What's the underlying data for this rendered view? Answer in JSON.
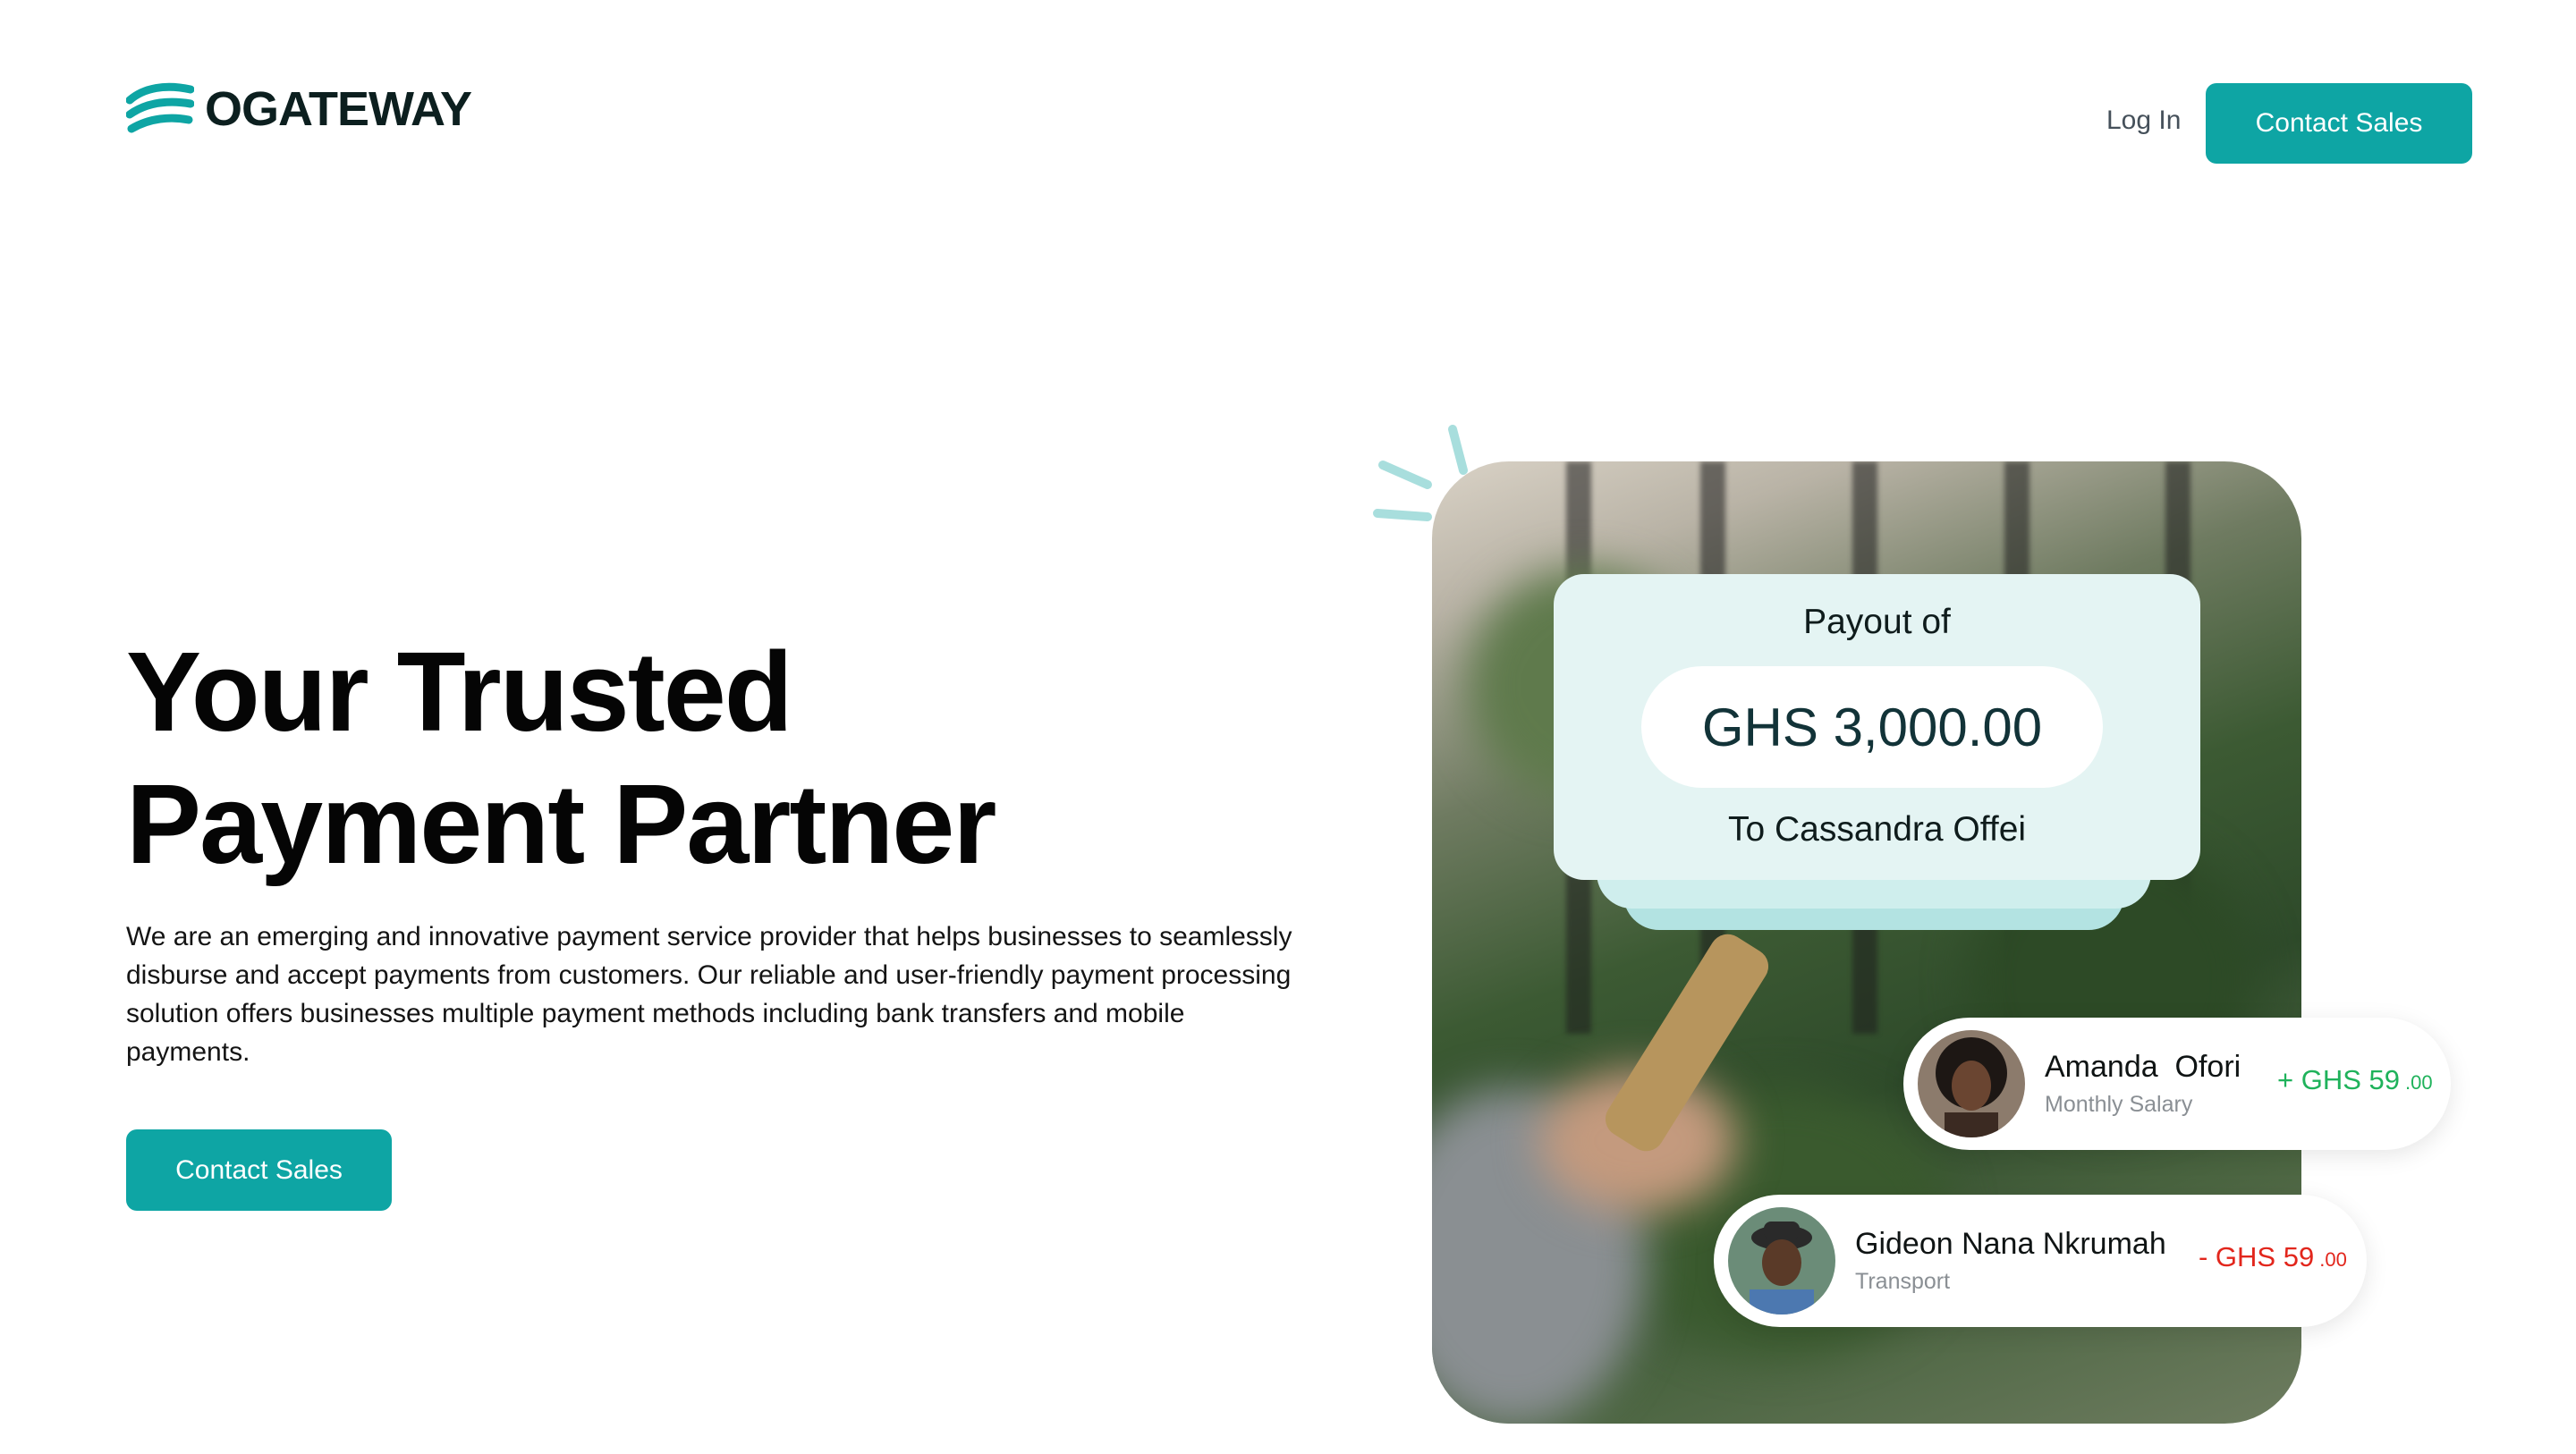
{
  "brand": {
    "name": "OGATEWAY",
    "accent": "#0ea5a4"
  },
  "nav": {
    "login_label": "Log In",
    "cta_label": "Contact Sales"
  },
  "hero": {
    "title_line1": "Your Trusted",
    "title_line2": "Payment Partner",
    "description": "We are an emerging and innovative payment service provider that helps businesses to seamlessly disburse and accept payments from customers. Our reliable and user-friendly payment processing solution offers businesses multiple payment methods including bank transfers and mobile payments.",
    "cta_label": "Contact Sales"
  },
  "payout": {
    "label": "Payout of",
    "amount": "GHS 3,000.00",
    "recipient": "To Cassandra Offei"
  },
  "transactions": [
    {
      "name": "Amanda  Ofori",
      "category": "Monthly Salary",
      "amount": "+ GHS 59",
      "cents": ".00",
      "color": "#1fb25b"
    },
    {
      "name": "Gideon Nana Nkrumah",
      "category": "Transport",
      "amount": "- GHS 59",
      "cents": ".00",
      "color": "#e2261c"
    }
  ]
}
